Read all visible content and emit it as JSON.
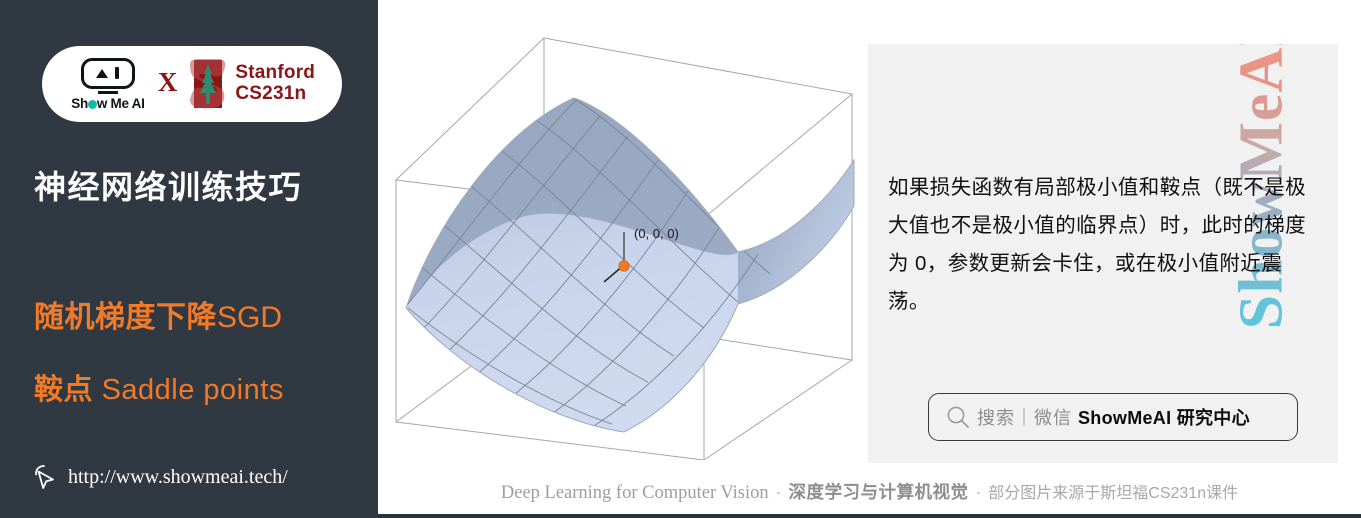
{
  "sidebar": {
    "logo": {
      "smai_name": "Show Me AI",
      "smai_o_glyph": "o-dot",
      "x_label": "X",
      "stanford_line1": "Stanford",
      "stanford_line2": "CS231n",
      "stanford_icon": "stanford-tree-s-icon"
    },
    "title": "神经网络训练技巧",
    "subtitle_cn": "随机梯度下降",
    "subtitle_en": "SGD",
    "topic_cn": "鞍点",
    "topic_en": " Saddle points",
    "cursor_icon": "click-cursor-icon",
    "url": "http://www.showmeai.tech/",
    "colors": {
      "background": "#303842",
      "accent_orange": "#F07A28",
      "title_white": "#FFFFFF",
      "stanford_red": "#8C1515",
      "smai_teal": "#14B8A6"
    }
  },
  "figure": {
    "caption_point_label": "(0, 0, 0)",
    "point_color": "#F07A28",
    "surface_color_light": "#C7D4EC",
    "surface_color_dark": "#8C9CB5",
    "grid_color": "#7C8899",
    "box_color": "#9AA0A6"
  },
  "panel": {
    "body_text": "如果损失函数有局部极小值和鞍点（既不是极大值也不是极小值的临界点）时，此时的梯度为 0，参数更新会卡住，或在极小值附近震荡。",
    "watermark": "ShowMeAI",
    "background": "#F1F1F1",
    "wechat": {
      "search_icon": "magnifier-icon",
      "label": "搜索｜微信",
      "brand": "ShowMeAI 研究中心"
    }
  },
  "footer": {
    "english": "Deep Learning for Computer Vision",
    "separator": "·",
    "chinese_bold": "深度学习与计算机视觉",
    "chinese_note": "部分图片来源于斯坦福CS231n课件"
  },
  "chart_data": {
    "type": "surface",
    "title": "",
    "function": "z = x^2 - y^2 (hyperbolic paraboloid / saddle surface)",
    "annotations": [
      {
        "label": "(0, 0, 0)",
        "x": 0,
        "y": 0,
        "z": 0,
        "marker": "point",
        "color": "#F07A28"
      }
    ],
    "xlabel": "",
    "ylabel": "",
    "zlabel": "",
    "grid": true,
    "legend": "none",
    "xlim": [
      -1,
      1
    ],
    "ylim": [
      -1,
      1
    ],
    "zlim": [
      -1,
      1
    ]
  }
}
